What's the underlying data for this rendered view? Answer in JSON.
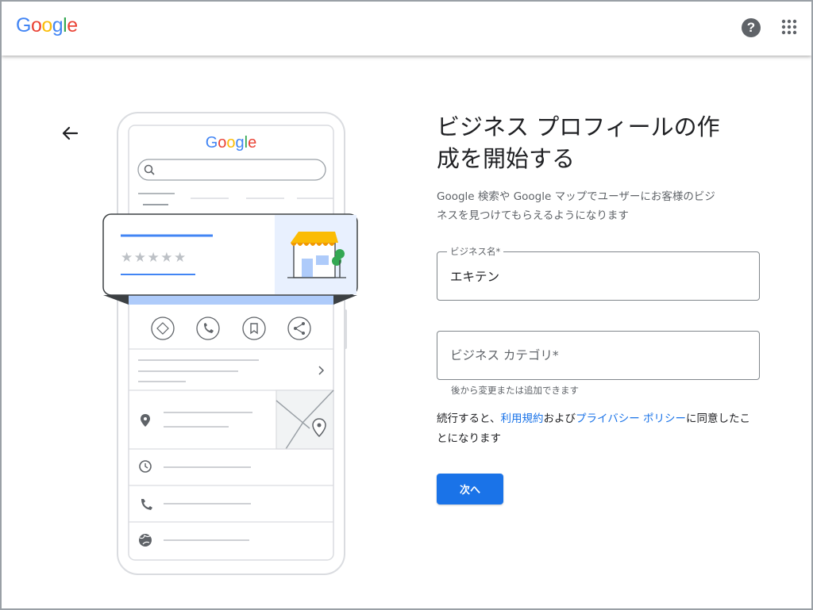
{
  "header": {
    "logo_letters": [
      "G",
      "o",
      "o",
      "g",
      "l",
      "e"
    ],
    "logo_colors": [
      "#4285F4",
      "#EA4335",
      "#FBBC05",
      "#4285F4",
      "#34A853",
      "#EA4335"
    ],
    "help_glyph": "?",
    "icons": [
      "help-icon",
      "apps-grid-icon"
    ]
  },
  "navigation": {
    "back_icon": "arrow-left-icon"
  },
  "illustration": {
    "logo_text": "Google",
    "stars": "★★★★★",
    "action_icons": [
      "directions-icon",
      "phone-icon",
      "bookmark-icon",
      "share-icon"
    ],
    "detail_icons": [
      "location-pin-icon",
      "clock-icon",
      "phone-icon",
      "globe-icon"
    ]
  },
  "form": {
    "title_line1": "ビジネス プロフィールの作",
    "title_line2": "成を開始する",
    "description_line1": "Google 検索や Google マップでユーザーにお客様のビジ",
    "description_line2": "ネスを見つけてもらえるようになります",
    "business_name": {
      "label": "ビジネス名*",
      "value": "エキテン"
    },
    "business_category": {
      "placeholder": "ビジネス カテゴリ*",
      "helper": "後から変更または追加できます"
    },
    "terms": {
      "prefix": "続行すると、",
      "terms_link": "利用規約",
      "middle": "および",
      "privacy_link": "プライバシー ポリシー",
      "suffix": "に同意したことになります"
    },
    "next_label": "次へ"
  },
  "colors": {
    "accent": "#1a73e8",
    "store_awning": "#fbbc04",
    "illustration_panel": "#e8f0fe"
  }
}
